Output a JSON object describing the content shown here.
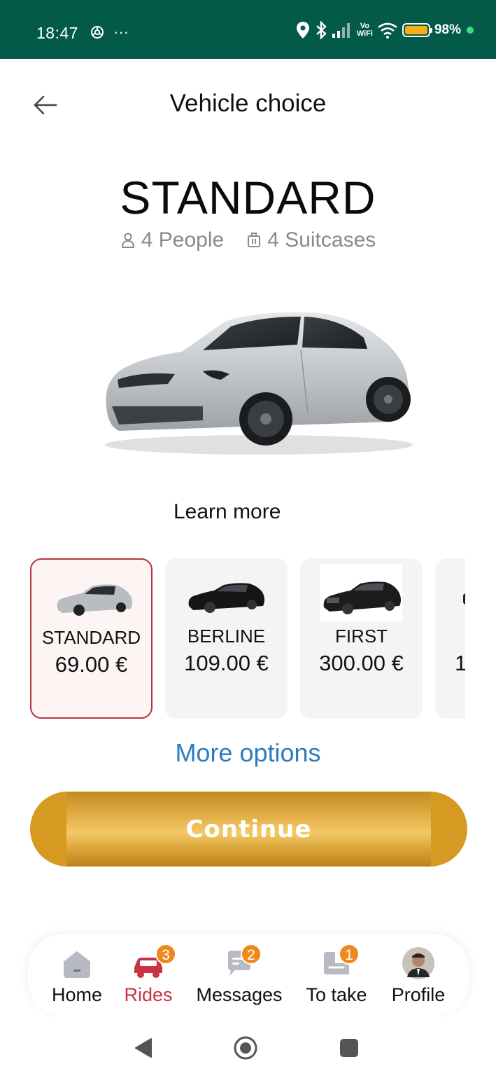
{
  "status_bar": {
    "time": "18:47",
    "extra": "···",
    "vowifi_top": "Vo",
    "vowifi_bottom": "WiFi",
    "battery": "98%",
    "battery_level": 0.98,
    "colors": {
      "background": "#035a48",
      "battery": "#f6b014",
      "dot": "#3ddc84"
    },
    "icons": [
      "openai-icon",
      "location-icon",
      "bluetooth-icon",
      "signal-icon",
      "wifi-icon",
      "battery-icon"
    ]
  },
  "header": {
    "back_icon": "arrow-left-icon",
    "title": "Vehicle choice"
  },
  "vehicle": {
    "name": "STANDARD",
    "people": "4 People",
    "suitcases": "4 Suitcases",
    "people_icon": "person-icon",
    "suitcase_icon": "suitcase-icon",
    "image": "silver-suv-image"
  },
  "learn_more": "Learn more",
  "cards": [
    {
      "name": "STANDARD",
      "price": "69.00 €",
      "selected": true,
      "car_color": "#b9bcc0"
    },
    {
      "name": "BERLINE",
      "price": "109.00 €",
      "selected": false,
      "car_color": "#151515"
    },
    {
      "name": "FIRST",
      "price": "300.00 €",
      "selected": false,
      "car_color": "#1c1c1c"
    },
    {
      "name": "",
      "price": "1",
      "selected": false,
      "car_color": "#222"
    }
  ],
  "more_options": "More options",
  "continue_label": "Continue",
  "accent": {
    "primary": "#c8343f",
    "link": "#2e7bbd",
    "gold": "#d69a22",
    "badge": "#ec8a1c"
  },
  "bottom_nav": [
    {
      "label": "Home",
      "icon": "home-icon",
      "badge": null,
      "active": false
    },
    {
      "label": "Rides",
      "icon": "car-icon",
      "badge": "3",
      "active": true
    },
    {
      "label": "Messages",
      "icon": "chat-icon",
      "badge": "2",
      "active": false
    },
    {
      "label": "To take",
      "icon": "seat-icon",
      "badge": "1",
      "active": false
    },
    {
      "label": "Profile",
      "icon": "avatar-icon",
      "badge": null,
      "active": false
    }
  ],
  "system_nav": [
    "back-triangle-icon",
    "home-circle-icon",
    "recents-square-icon"
  ]
}
